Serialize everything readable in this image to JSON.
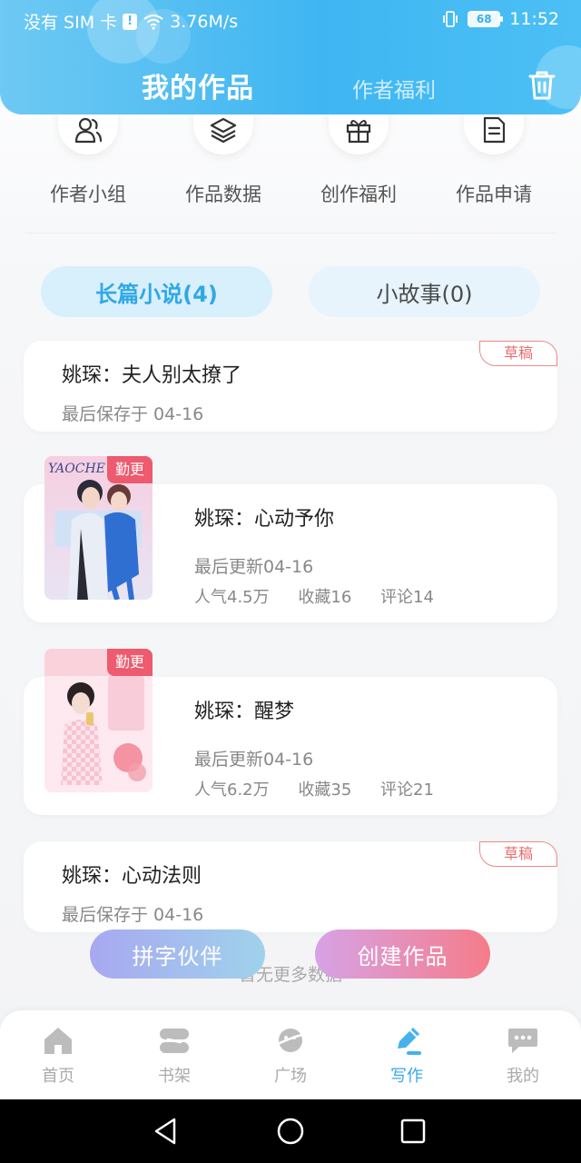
{
  "status_bar": {
    "carrier": "没有 SIM 卡",
    "sim_alert": "!",
    "speed": "3.76M/s",
    "battery": "68",
    "time": "11:52"
  },
  "header": {
    "tab_active": "我的作品",
    "tab_inactive": "作者福利",
    "trash_icon": "trash-icon"
  },
  "quick_actions": [
    {
      "label": "作者小组",
      "icon": "group-icon"
    },
    {
      "label": "作品数据",
      "icon": "layers-icon"
    },
    {
      "label": "创作福利",
      "icon": "gift-icon"
    },
    {
      "label": "作品申请",
      "icon": "document-icon"
    }
  ],
  "segments": {
    "novel": "长篇小说(4)",
    "story": "小故事(0)"
  },
  "works": [
    {
      "type": "draft",
      "title": "姚琛：夫人别太撩了",
      "subtitle": "最后保存于 04-16",
      "badge": "草稿"
    },
    {
      "type": "book",
      "title": "姚琛：心动予你",
      "updated": "最后更新04-16",
      "popularity": "人气4.5万",
      "favorites": "收藏16",
      "comments": "评论14",
      "badge": "勤更",
      "cover_text": "YAOCHE"
    },
    {
      "type": "book",
      "title": "姚琛：醒梦",
      "updated": "最后更新04-16",
      "popularity": "人气6.2万",
      "favorites": "收藏35",
      "comments": "评论21",
      "badge": "勤更"
    },
    {
      "type": "draft",
      "title": "姚琛：心动法则",
      "subtitle": "最后保存于 04-16",
      "badge": "草稿"
    }
  ],
  "no_more": "暂无更多数据",
  "buttons": {
    "partner": "拼字伙伴",
    "create": "创建作品"
  },
  "bottom_nav": [
    {
      "label": "首页",
      "icon": "home-icon"
    },
    {
      "label": "书架",
      "icon": "bookshelf-icon"
    },
    {
      "label": "广场",
      "icon": "planet-icon"
    },
    {
      "label": "写作",
      "icon": "pen-icon",
      "active": true
    },
    {
      "label": "我的",
      "icon": "chat-bubble-icon"
    }
  ],
  "colors": {
    "header_blue": "#3fb6f2",
    "active_blue": "#3aa8e6",
    "draft_red": "#e86c6c",
    "badge_red": "#ee5a6e"
  }
}
